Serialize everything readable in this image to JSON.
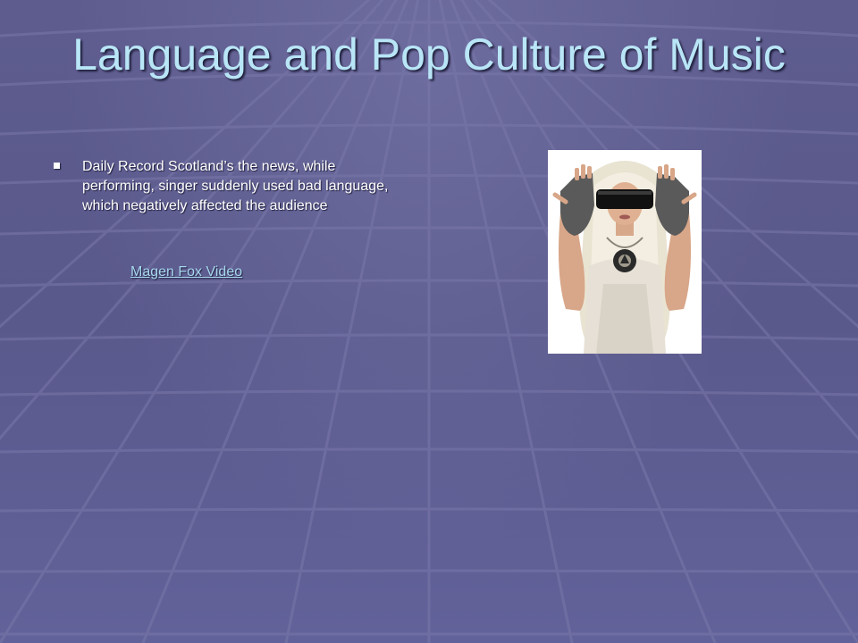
{
  "slide": {
    "title": "Language and Pop Culture of Music",
    "bullets": [
      "Daily Record Scotland’s the news, while performing, singer suddenly used bad language, which negatively affected the audience"
    ],
    "link_text": "Magen Fox Video"
  },
  "colors": {
    "background": "#5e5c8e",
    "title": "#b9e6f7",
    "body_text": "#ffffff",
    "link": "#a8d8f0"
  }
}
